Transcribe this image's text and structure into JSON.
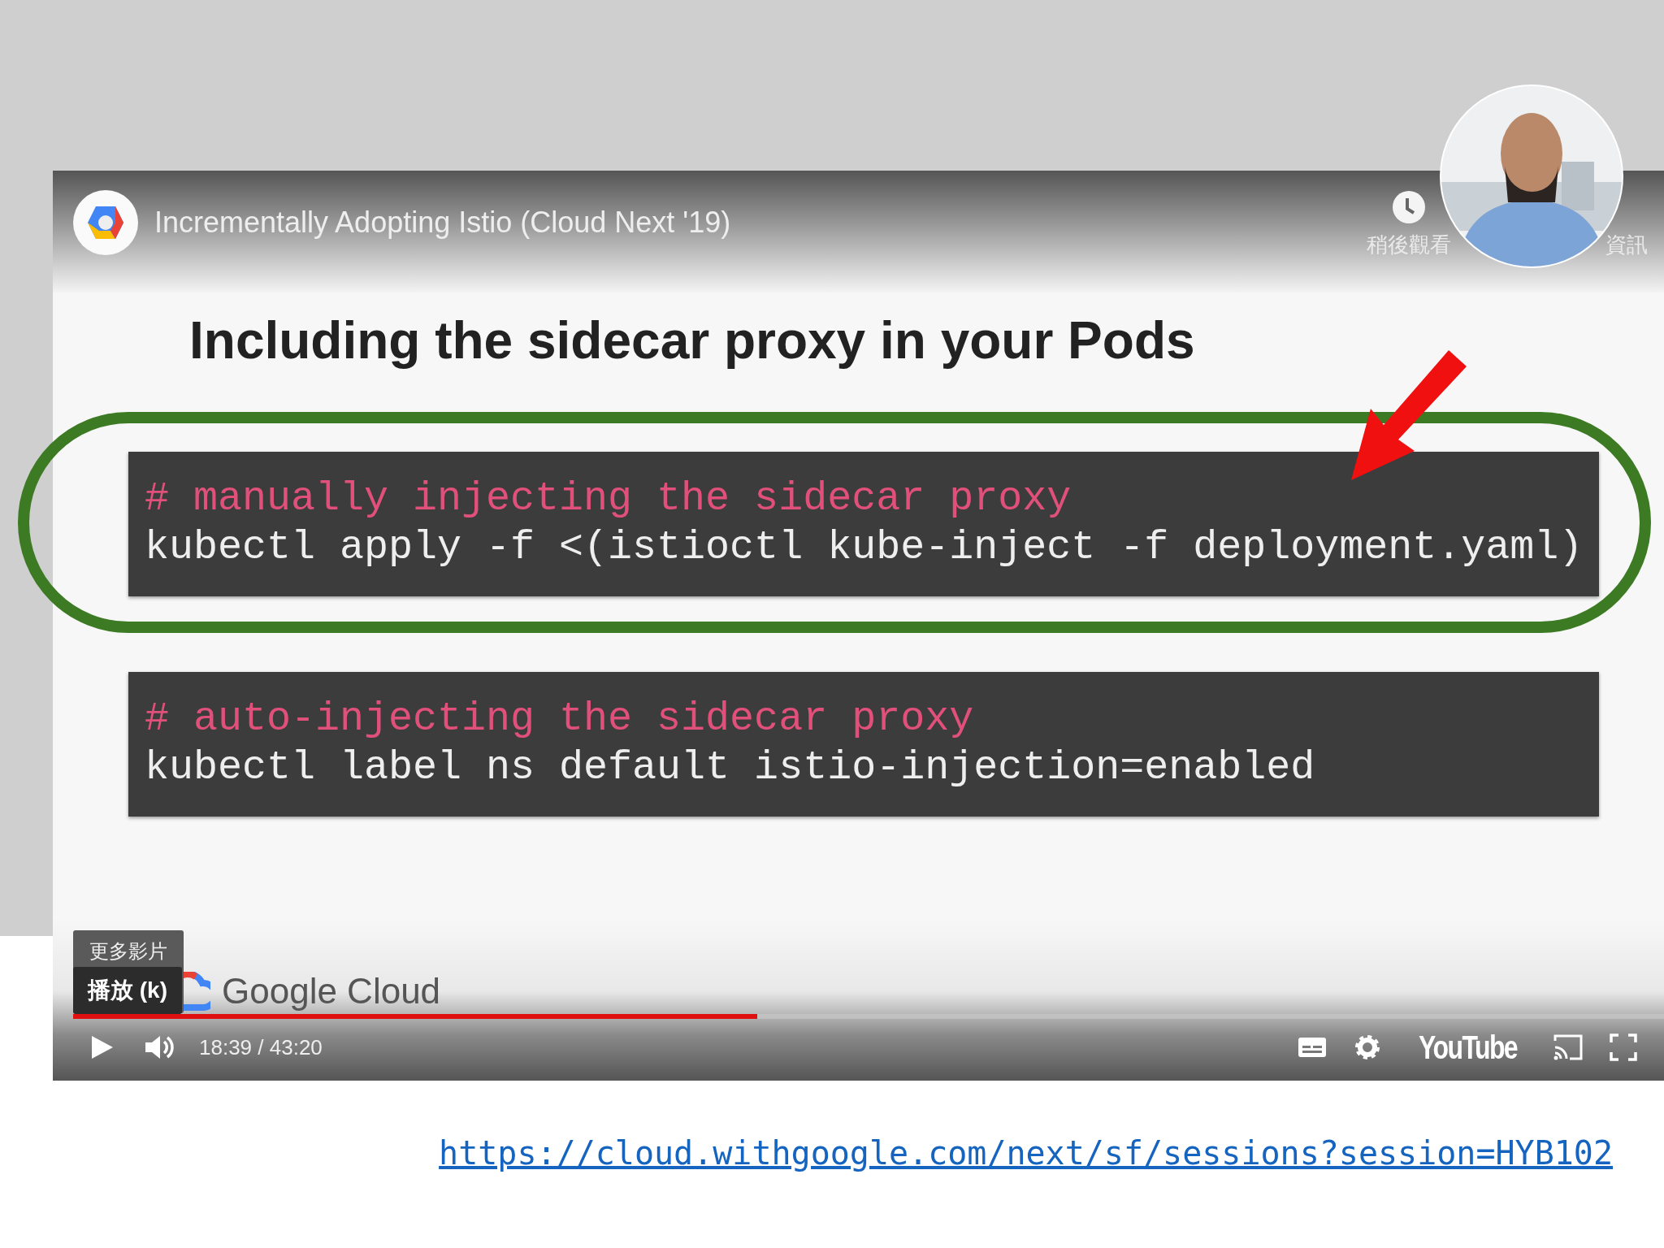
{
  "video": {
    "title": "Incrementally Adopting Istio (Cloud Next '19)",
    "top_actions": [
      {
        "kind": "watch-later",
        "label": "稍後觀看"
      },
      {
        "kind": "info",
        "label": "資訊"
      }
    ],
    "slide": {
      "heading": "Including the sidecar proxy in your Pods",
      "code_blocks": [
        {
          "comment": "# manually injecting the sidecar proxy",
          "command": "kubectl apply -f <(istioctl kube-inject -f deployment.yaml)",
          "highlighted": true
        },
        {
          "comment": "# auto-injecting the sidecar proxy",
          "command": "kubectl label ns default istio-injection=enabled",
          "highlighted": false
        }
      ],
      "footer_logo": "Google Cloud"
    },
    "tooltip": {
      "behind": "更多影片",
      "label": "播放 (k)"
    },
    "progress": {
      "level": 0.43
    },
    "time": "18:39 / 43:20",
    "brand": "YouTube"
  },
  "link": "https://cloud.withgoogle.com/next/sf/sessions?session=HYB102"
}
